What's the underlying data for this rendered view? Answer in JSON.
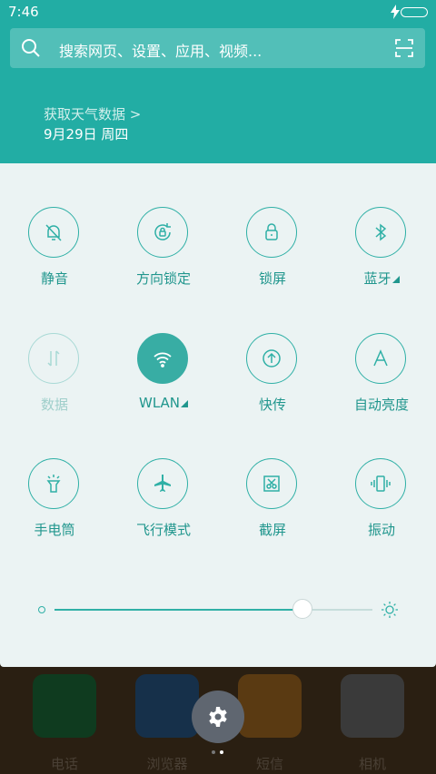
{
  "status_bar": {
    "time": "7:46"
  },
  "search": {
    "placeholder": "搜索网页、设置、应用、视频..."
  },
  "header": {
    "weather_link": "获取天气数据 >",
    "date": "9月29日 周四"
  },
  "toggles": [
    {
      "label": "静音",
      "icon": "bell-off-icon",
      "state": "off"
    },
    {
      "label": "方向锁定",
      "icon": "rotation-lock-icon",
      "state": "off"
    },
    {
      "label": "锁屏",
      "icon": "lock-icon",
      "state": "off"
    },
    {
      "label": "蓝牙",
      "icon": "bluetooth-icon",
      "state": "off",
      "has_menu": true
    },
    {
      "label": "数据",
      "icon": "mobile-data-icon",
      "state": "disabled"
    },
    {
      "label": "WLAN",
      "icon": "wifi-icon",
      "state": "on",
      "has_menu": true
    },
    {
      "label": "快传",
      "icon": "quick-transfer-icon",
      "state": "off"
    },
    {
      "label": "自动亮度",
      "icon": "auto-brightness-icon",
      "state": "off"
    },
    {
      "label": "手电筒",
      "icon": "flashlight-icon",
      "state": "off"
    },
    {
      "label": "飞行模式",
      "icon": "airplane-icon",
      "state": "off"
    },
    {
      "label": "截屏",
      "icon": "screenshot-icon",
      "state": "off"
    },
    {
      "label": "振动",
      "icon": "vibrate-icon",
      "state": "off"
    }
  ],
  "brightness": {
    "level_percent": 78
  },
  "dock": [
    {
      "label": "电话",
      "icon": "phone-icon",
      "color": "#1a7a3c"
    },
    {
      "label": "浏览器",
      "icon": "browser-icon",
      "color": "#2a6fa8"
    },
    {
      "label": "短信",
      "icon": "message-icon",
      "color": "#e08a1a"
    },
    {
      "label": "相机",
      "icon": "camera-icon",
      "color": "#6a6a6a"
    }
  ],
  "colors": {
    "accent": "#22ada4",
    "panel": "#ebf3f3"
  }
}
